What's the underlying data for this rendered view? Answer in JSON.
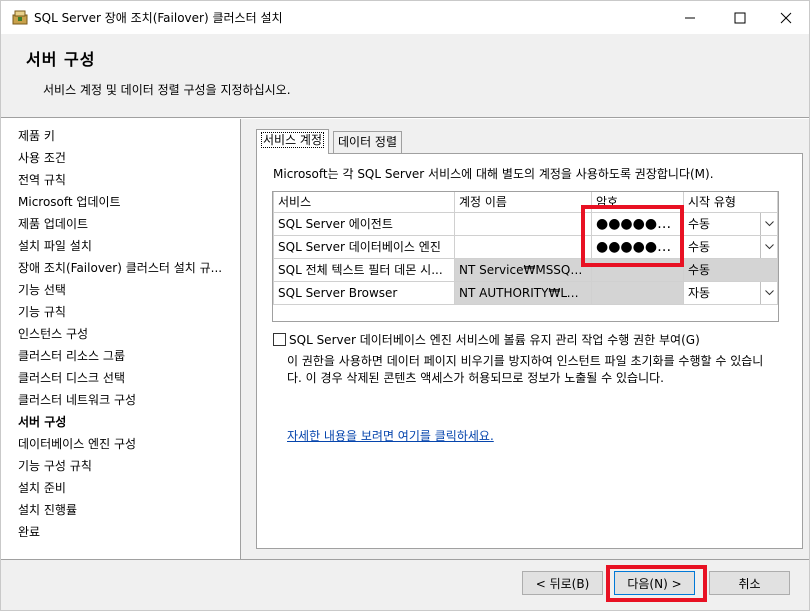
{
  "window": {
    "title": "SQL Server 장애 조치(Failover) 클러스터 설치",
    "icon": "sql-setup-icon",
    "controls": [
      "minimize-icon",
      "maximize-icon",
      "close-icon"
    ]
  },
  "header": {
    "title": "서버 구성",
    "subtitle": "서비스 계정 및 데이터 정렬 구성을 지정하십시오."
  },
  "nav": {
    "items": [
      {
        "label": "제품 키",
        "active": false
      },
      {
        "label": "사용 조건",
        "active": false
      },
      {
        "label": "전역 규칙",
        "active": false
      },
      {
        "label": "Microsoft 업데이트",
        "active": false
      },
      {
        "label": "제품 업데이트",
        "active": false
      },
      {
        "label": "설치 파일 설치",
        "active": false
      },
      {
        "label": "장애 조치(Failover) 클러스터 설치 규...",
        "active": false
      },
      {
        "label": "기능 선택",
        "active": false
      },
      {
        "label": "기능 규칙",
        "active": false
      },
      {
        "label": "인스턴스 구성",
        "active": false
      },
      {
        "label": "클러스터 리소스 그룹",
        "active": false
      },
      {
        "label": "클러스터 디스크 선택",
        "active": false
      },
      {
        "label": "클러스터 네트워크 구성",
        "active": false
      },
      {
        "label": "서버 구성",
        "active": true
      },
      {
        "label": "데이터베이스 엔진 구성",
        "active": false
      },
      {
        "label": "기능 구성 규칙",
        "active": false
      },
      {
        "label": "설치 준비",
        "active": false
      },
      {
        "label": "설치 진행률",
        "active": false
      },
      {
        "label": "완료",
        "active": false
      }
    ]
  },
  "tabs": {
    "service_accounts": "서비스 계정",
    "collation": "데이터 정렬"
  },
  "panel": {
    "recommendation": "Microsoft는 각 SQL Server 서비스에 대해 별도의 계정을 사용하도록 권장합니다(M).",
    "columns": [
      "서비스",
      "계정 이름",
      "암호",
      "시작 유형"
    ],
    "rows": [
      {
        "service": "SQL Server 에이전트",
        "account": "",
        "password": "●●●●●●...",
        "startup": "수동",
        "combo": true
      },
      {
        "service": "SQL Server 데이터베이스 엔진",
        "account": "",
        "password": "●●●●●●...",
        "startup": "수동",
        "combo": true
      },
      {
        "service": "SQL 전체 텍스트 필터 데몬 시...",
        "account": "NT Service₩MSSQLF...",
        "password": "",
        "startup": "수동",
        "combo": false
      },
      {
        "service": "SQL Server Browser",
        "account": "NT AUTHORITY₩LOC...",
        "password": "",
        "startup": "자동",
        "combo": true
      }
    ],
    "checkbox_label": "SQL Server 데이터베이스 엔진 서비스에 볼륨 유지 관리 작업 수행 권한 부여(G)",
    "checkbox_checked": false,
    "description": "이 권한을 사용하면 데이터 페이지 비우기를 방지하여 인스턴트 파일 초기화를 수행할 수 있습니다. 이 경우 삭제된 콘텐츠 액세스가 허용되므로 정보가 노출될 수 있습니다.",
    "link": "자세한 내용을 보려면 여기를 클릭하세요."
  },
  "buttons": {
    "back": "< 뒤로(B)",
    "next": "다음(N) >",
    "cancel": "취소"
  },
  "colors": {
    "highlight": "#e81123",
    "link": "#0645ad"
  }
}
